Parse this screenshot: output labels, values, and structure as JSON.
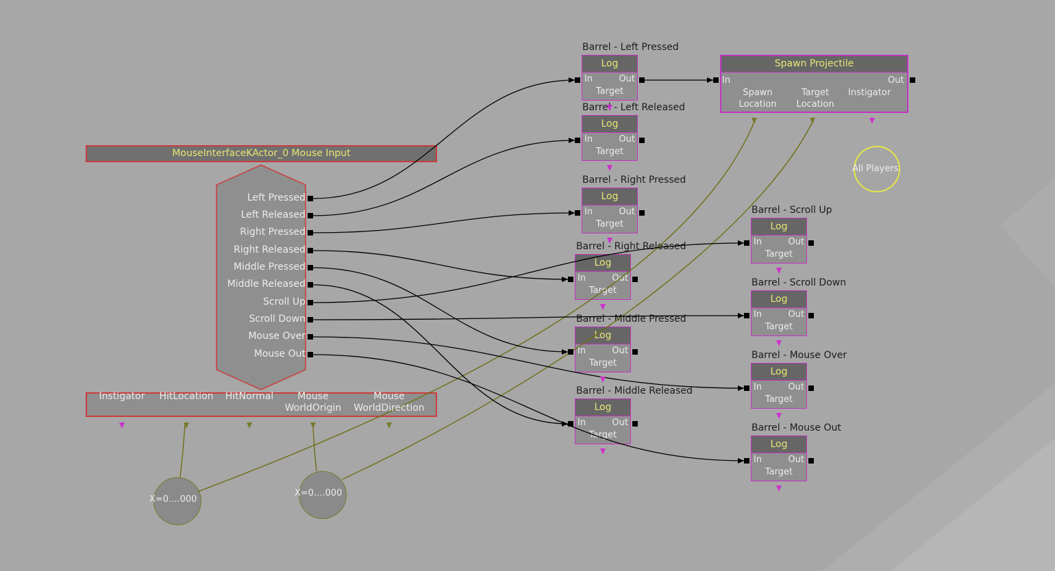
{
  "mouse_input": {
    "title": "MouseInterfaceKActor_0 Mouse Input",
    "outputs": [
      "Left Pressed",
      "Left Released",
      "Right Pressed",
      "Right Released",
      "Middle Pressed",
      "Middle Released",
      "Scroll Up",
      "Scroll Down",
      "Mouse Over",
      "Mouse Out"
    ],
    "variables": [
      {
        "line1": "Instigator",
        "line2": ""
      },
      {
        "line1": "HitLocation",
        "line2": ""
      },
      {
        "line1": "HitNormal",
        "line2": ""
      },
      {
        "line1": "Mouse",
        "line2": "WorldOrigin"
      },
      {
        "line1": "Mouse",
        "line2": "WorldDirection"
      }
    ]
  },
  "log_nodes": [
    {
      "title": "Barrel - Left Pressed",
      "header": "Log",
      "in": "In",
      "out": "Out",
      "target": "Target"
    },
    {
      "title": "Barrel - Left Released",
      "header": "Log",
      "in": "In",
      "out": "Out",
      "target": "Target"
    },
    {
      "title": "Barrel - Right Pressed",
      "header": "Log",
      "in": "In",
      "out": "Out",
      "target": "Target"
    },
    {
      "title": "Barrel - Right Released",
      "header": "Log",
      "in": "In",
      "out": "Out",
      "target": "Target"
    },
    {
      "title": "Barrel - Middle Pressed",
      "header": "Log",
      "in": "In",
      "out": "Out",
      "target": "Target"
    },
    {
      "title": "Barrel - Middle Released",
      "header": "Log",
      "in": "In",
      "out": "Out",
      "target": "Target"
    },
    {
      "title": "Barrel - Scroll Up",
      "header": "Log",
      "in": "In",
      "out": "Out",
      "target": "Target"
    },
    {
      "title": "Barrel - Scroll Down",
      "header": "Log",
      "in": "In",
      "out": "Out",
      "target": "Target"
    },
    {
      "title": "Barrel - Mouse Over",
      "header": "Log",
      "in": "In",
      "out": "Out",
      "target": "Target"
    },
    {
      "title": "Barrel - Mouse Out",
      "header": "Log",
      "in": "In",
      "out": "Out",
      "target": "Target"
    }
  ],
  "spawn_node": {
    "header": "Spawn Projectile",
    "in": "In",
    "out": "Out",
    "spawn_location": {
      "line1": "Spawn",
      "line2": "Location"
    },
    "target_location": {
      "line1": "Target",
      "line2": "Location"
    },
    "instigator": "Instigator"
  },
  "variable_nodes": [
    {
      "label": "X=0....000"
    },
    {
      "label": "X=0....000"
    }
  ],
  "all_players": {
    "label": "All Players"
  },
  "colors": {
    "background": "#a7a7a7",
    "node_body": "#8f8f8f",
    "node_header": "#666666",
    "header_text": "#e6e675",
    "action_border": "#c234c2",
    "event_border": "#cc3c3c",
    "object_pin": "#cc33cc",
    "vector_pin": "#7a7a2e",
    "exec_wire": "#000000",
    "vector_wire": "#6e6e14",
    "all_players_ring": "#e6e64a"
  }
}
